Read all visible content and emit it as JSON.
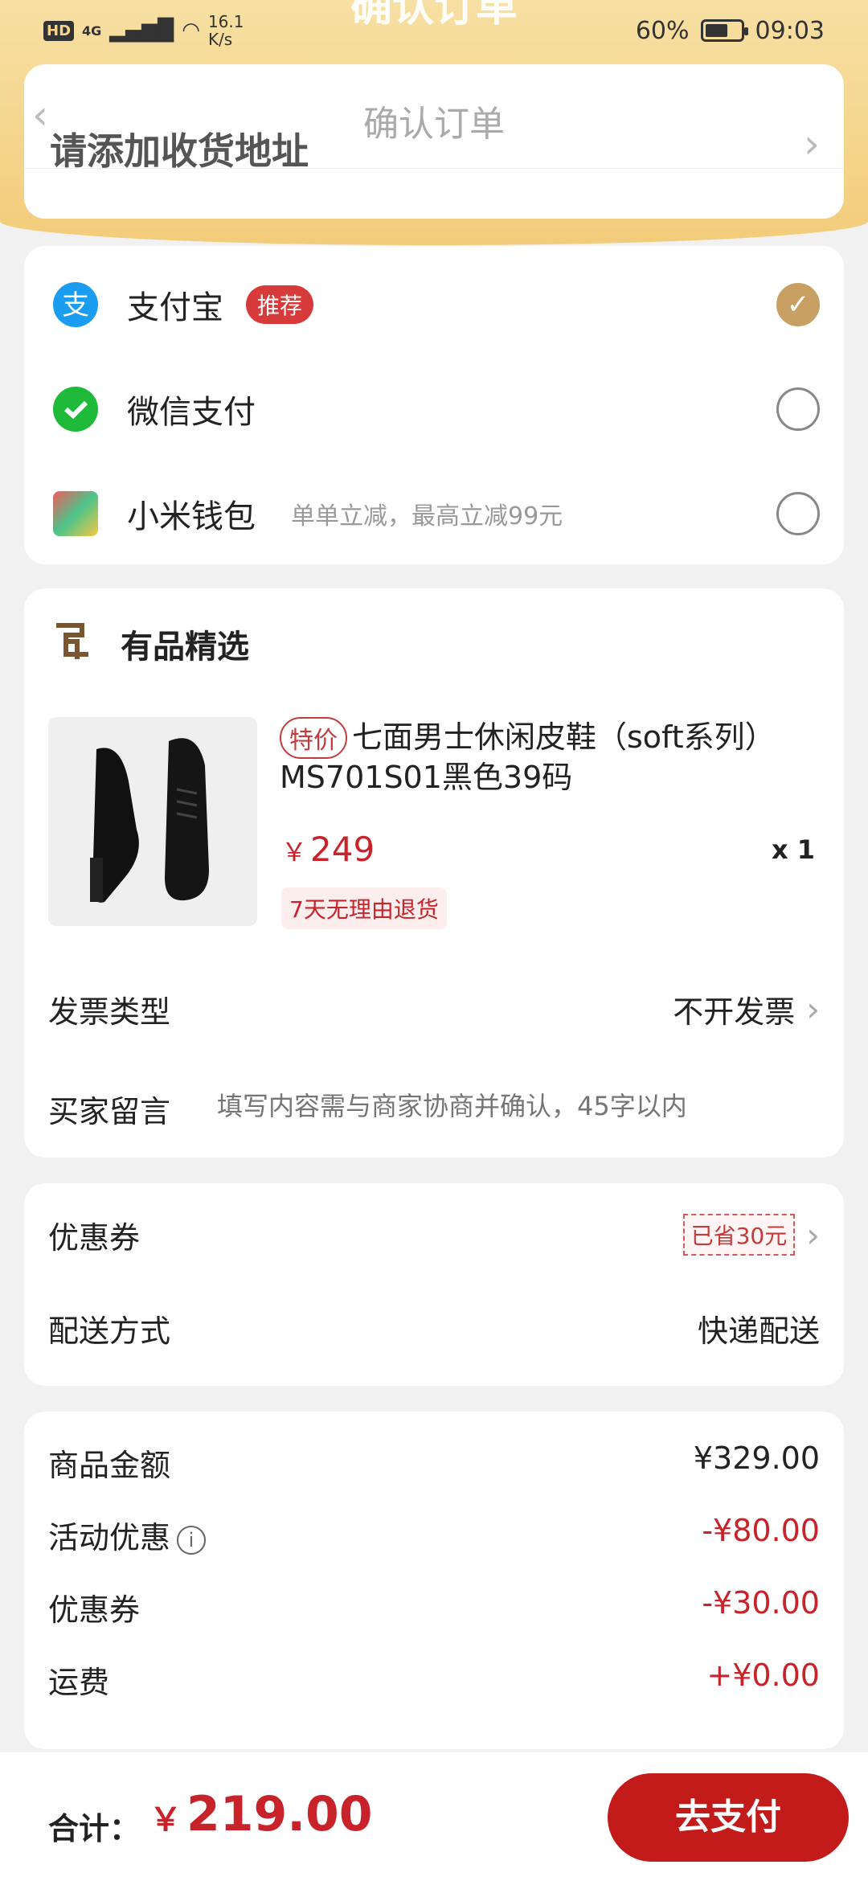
{
  "status": {
    "hd": "HD",
    "network": "4G",
    "speed_value": "16.1",
    "speed_unit": "K/s",
    "battery": "60%",
    "time": "09:03"
  },
  "header": {
    "bg_title": "确认订单",
    "title": "确认订单",
    "address_prompt": "请添加收货地址"
  },
  "payment": {
    "options": [
      {
        "label": "支付宝",
        "tag": "推荐",
        "icon": "alipay-icon",
        "selected": true
      },
      {
        "label": "微信支付",
        "icon": "wechat-pay-icon",
        "selected": false
      },
      {
        "label": "小米钱包",
        "sub": "单单立减，最高立减99元",
        "icon": "mi-wallet-icon",
        "selected": false
      }
    ],
    "check_glyph": "✓"
  },
  "shop": {
    "name": "有品精选",
    "product": {
      "tag": "特价",
      "title": "七面男士休闲皮鞋（soft系列）MS701S01黑色39码",
      "currency": "￥",
      "price": "249",
      "qty": "x 1",
      "return_tag": "7天无理由退货"
    },
    "invoice_label": "发票类型",
    "invoice_value": "不开发票",
    "message_label": "买家留言",
    "message_placeholder": "填写内容需与商家协商并确认，45字以内"
  },
  "coupon": {
    "label": "优惠券",
    "saved": "已省30元",
    "delivery_label": "配送方式",
    "delivery_value": "快递配送"
  },
  "summary": {
    "rows": [
      {
        "label": "商品金额",
        "value": "¥329.00",
        "red": false
      },
      {
        "label": "活动优惠",
        "value": "-¥80.00",
        "red": true,
        "info": true
      },
      {
        "label": "优惠券",
        "value": "-¥30.00",
        "red": true
      },
      {
        "label": "运费",
        "value": "+¥0.00",
        "red": true
      }
    ],
    "info_glyph": "i"
  },
  "footer": {
    "total_label": "合计：",
    "currency": "￥",
    "total": "219.00",
    "pay_button": "去支付"
  },
  "colors": {
    "accent": "#c8232a",
    "gold": "#c8a063",
    "hero": "#f3cc7a"
  }
}
